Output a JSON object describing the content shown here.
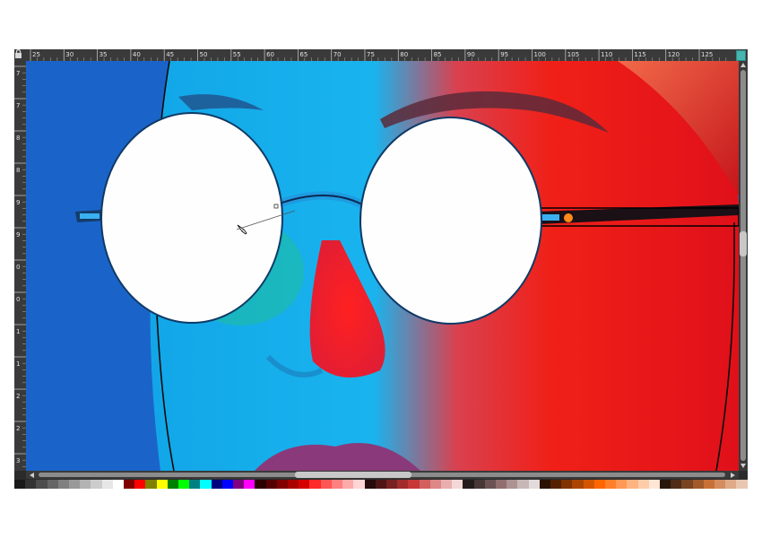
{
  "ruler": {
    "h_labels": [
      "25",
      "30",
      "35",
      "40",
      "45",
      "50",
      "55",
      "60",
      "65",
      "70",
      "75",
      "80",
      "85",
      "90",
      "95",
      "100",
      "105",
      "110",
      "115",
      "120",
      "125"
    ],
    "v_labels": [
      "7",
      "7",
      "8",
      "8",
      "9",
      "9",
      "0",
      "0",
      "1",
      "1",
      "2",
      "2",
      "3",
      "3"
    ]
  },
  "icons": {
    "lock": "lock-icon",
    "ruler_toggle": "ruler-toggle-icon",
    "pen_cursor": "pen-tool-cursor-icon"
  },
  "canvas": {
    "content": "photo of woman with round glasses, blue and red lighting",
    "selection": "glasses temple arm selected"
  },
  "colors": {
    "chrome": "#2b2b2b",
    "ruler": "#3a3a3a",
    "accent": "#47b5b0",
    "bg_blue": "#1a64c9",
    "face_red": "#e2131a"
  },
  "palette": [
    "#1a1a1a",
    "#333333",
    "#4d4d4d",
    "#666666",
    "#808080",
    "#999999",
    "#b3b3b3",
    "#cccccc",
    "#e6e6e6",
    "#ffffff",
    "#800000",
    "#ff0000",
    "#808000",
    "#ffff00",
    "#008000",
    "#00ff00",
    "#008080",
    "#00ffff",
    "#000080",
    "#0000ff",
    "#800080",
    "#ff00ff",
    "#2b0000",
    "#550000",
    "#800000",
    "#aa0000",
    "#d40000",
    "#ff2a2a",
    "#ff5555",
    "#ff8080",
    "#ffaaaa",
    "#ffd5d5",
    "#280b0b",
    "#501616",
    "#782121",
    "#a02c2c",
    "#c83737",
    "#d35f5f",
    "#de8787",
    "#e9afaf",
    "#f4d7d7",
    "#241c1c",
    "#483737",
    "#6c5353",
    "#916f6f",
    "#ac9393",
    "#c8b7b7",
    "#e3dbdb",
    "#2b1100",
    "#552200",
    "#803300",
    "#aa4400",
    "#d45500",
    "#ff6600",
    "#ff7f2a",
    "#ff9955",
    "#ffb380",
    "#ffccaa",
    "#ffe6d5",
    "#28170b",
    "#502d16",
    "#784421",
    "#a05a2c",
    "#c87137",
    "#d38d5f",
    "#deaa87",
    "#e9c6af"
  ]
}
